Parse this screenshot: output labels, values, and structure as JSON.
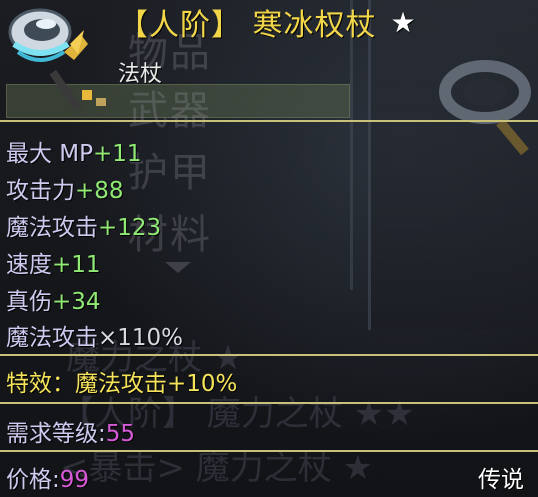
{
  "background_menu": {
    "categories": [
      "物品",
      "武器",
      "护甲",
      "材料"
    ],
    "ghost_rows": [
      "魔力之杖 ★",
      "【人阶】 魔力之杖 ★★",
      "<暴击> 魔力之杖 ★"
    ]
  },
  "tooltip": {
    "title": "【人阶】 寒冰权杖",
    "star": "★",
    "item_type": "法杖",
    "stats": [
      {
        "name": "最大 MP",
        "value": "+11"
      },
      {
        "name": "攻击力",
        "value": "+88"
      },
      {
        "name": "魔法攻击",
        "value": "+123"
      },
      {
        "name": "速度",
        "value": "+11"
      },
      {
        "name": "真伤",
        "value": "+34"
      }
    ],
    "percent_stat": {
      "name": "魔法攻击",
      "value": "×110%"
    },
    "special_effect": "特效：魔法攻击+10%",
    "requirement": {
      "label": "需求等级:",
      "value": "55"
    },
    "price": {
      "label": "价格:",
      "value": "99"
    },
    "rarity": "传说"
  },
  "icons": [
    "ice-staff-icon"
  ],
  "colors": {
    "title": "#f2d64a",
    "stat_value": "#90ea74",
    "stat_name": "#cfcaf0",
    "effect": "#f5e35a",
    "level_price": "#d65ad8",
    "divider": "#c9c07a"
  }
}
